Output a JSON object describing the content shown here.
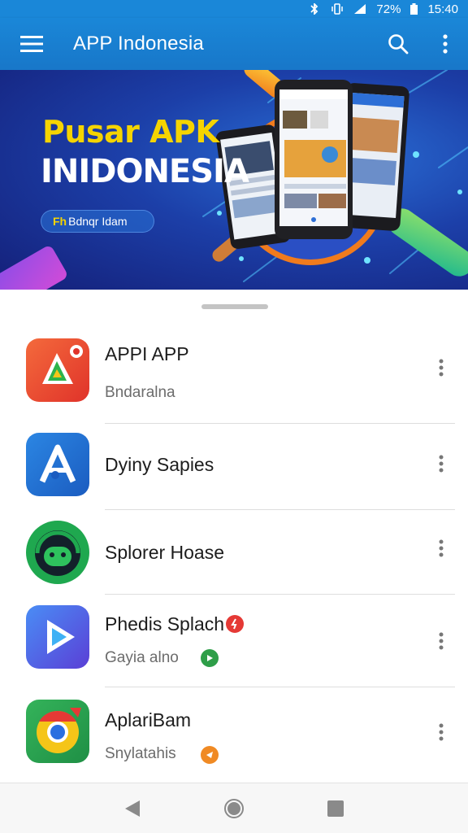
{
  "status_bar": {
    "battery": "72%",
    "time": "15:40"
  },
  "app_bar": {
    "title": "APP Indonesia"
  },
  "hero": {
    "title_line1": "Pusar APK",
    "title_line2": "INIDONESIA",
    "chip_mark": "Fh",
    "chip_text": "Bdnqr Idam"
  },
  "apps": [
    {
      "name": "APPI APP",
      "subtitle": "Bndaralna",
      "icon": "play-triangle-icon",
      "color": "#e8472f"
    },
    {
      "name": "Dyiny Sapies",
      "subtitle": "",
      "icon": "letter-a-icon",
      "color": "#1f6fd1"
    },
    {
      "name": "Splorer Hoase",
      "subtitle": "",
      "icon": "headset-face-icon",
      "color": "#1fa84f"
    },
    {
      "name": "Phedis Splach",
      "subtitle": "Gayia alno",
      "icon": "play-icon",
      "color": "#3b6ff0"
    },
    {
      "name": "AplariBam",
      "subtitle": "Snylatahis",
      "icon": "chrome-icon",
      "color": "#2aa04f"
    }
  ],
  "colors": {
    "primary": "#1a87d8",
    "hero_yellow": "#f5d400",
    "badge_red": "#e53935",
    "badge_green": "#2e9e48",
    "badge_orange": "#f08a24"
  }
}
